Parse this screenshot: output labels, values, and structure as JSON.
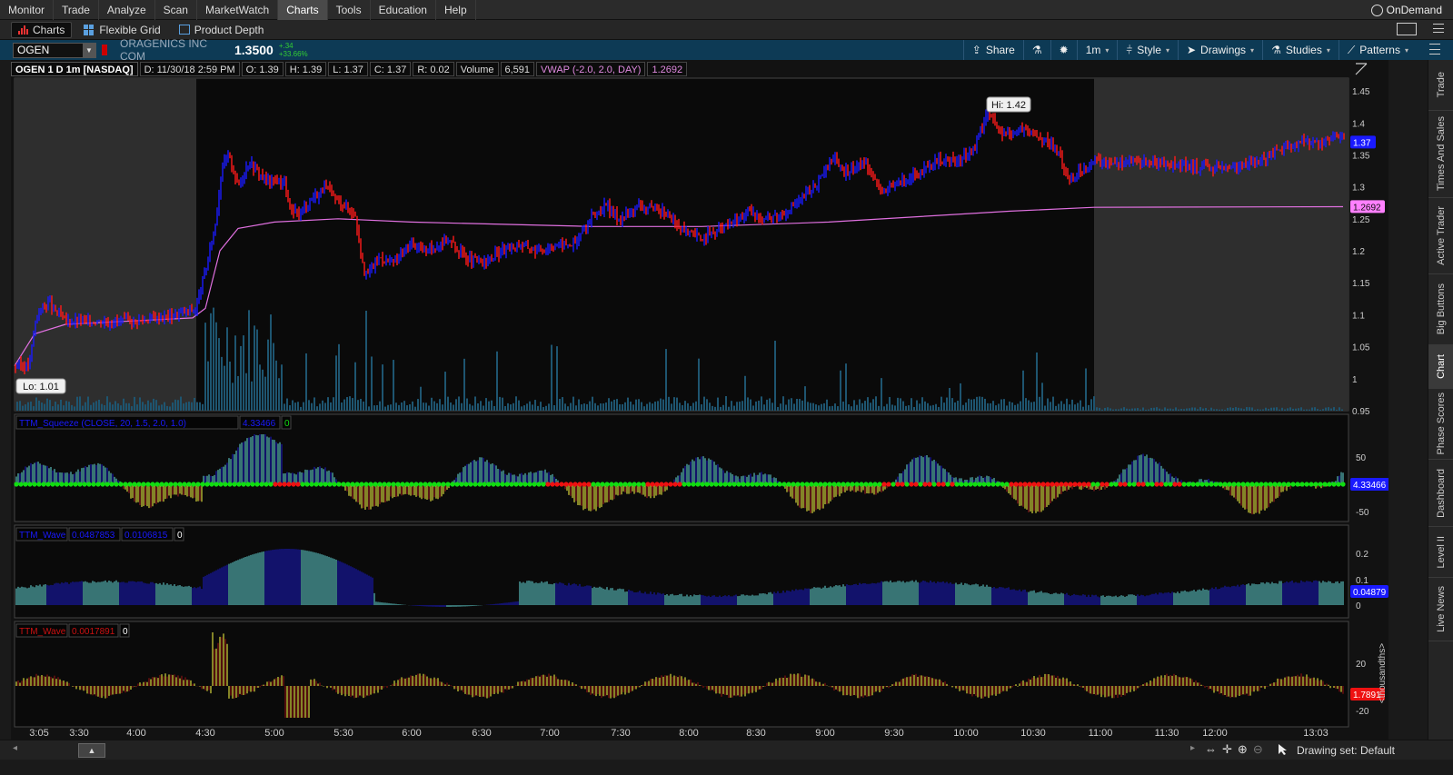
{
  "menu": {
    "items": [
      "Monitor",
      "Trade",
      "Analyze",
      "Scan",
      "MarketWatch",
      "Charts",
      "Tools",
      "Education",
      "Help"
    ],
    "active": "Charts",
    "ondemand": "OnDemand"
  },
  "subtabs": {
    "charts": "Charts",
    "flexible_grid": "Flexible Grid",
    "product_depth": "Product Depth"
  },
  "symbol": {
    "ticker": "OGEN",
    "company": "ORAGENICS INC COM",
    "last": "1.3500",
    "change_abs": "+.34",
    "change_pct": "+33.66%"
  },
  "toolbar": {
    "share": "Share",
    "interval": "1m",
    "style": "Style",
    "drawings": "Drawings",
    "studies": "Studies",
    "patterns": "Patterns"
  },
  "info": {
    "title": "OGEN 1 D 1m [NASDAQ]",
    "date": "D: 11/30/18 2:59 PM",
    "open": "O: 1.39",
    "high": "H: 1.39",
    "low": "L: 1.37",
    "close": "C: 1.37",
    "range": "R: 0.02",
    "volume_label": "Volume",
    "volume": "6,591",
    "vwap_label": "VWAP (-2.0, 2.0, DAY)",
    "vwap": "1.2692"
  },
  "price_panel": {
    "y_ticks": [
      "1.45",
      "1.4",
      "1.35",
      "1.3",
      "1.25",
      "1.2",
      "1.15",
      "1.1",
      "1.05",
      "1",
      "0.95"
    ],
    "ylim": [
      0.95,
      1.47
    ],
    "hi_label": "Hi: 1.42",
    "lo_label": "Lo: 1.01",
    "last_badge": "1.37",
    "vwap_badge": "1.2692"
  },
  "squeeze_panel": {
    "title": "TTM_Squeeze (CLOSE, 20, 1.5, 2.0, 1.0)",
    "value": "4.33466",
    "signal": "0",
    "y_ticks": [
      "50",
      "0",
      "-50"
    ],
    "badge": "4.33466"
  },
  "wave1_panel": {
    "title": "TTM_Wave",
    "value1": "0.0487853",
    "value2": "0.0106815",
    "value3": "0",
    "y_ticks": [
      "0.2",
      "0.1",
      "0"
    ],
    "badge": "0.04879"
  },
  "wave2_panel": {
    "title": "TTM_Wave",
    "value1": "0.0017891",
    "value2": "0",
    "y_ticks": [
      "20",
      "-20"
    ],
    "unit": "<thousandths>",
    "badge": "1.7891"
  },
  "x_axis": {
    "labels": [
      "3:05",
      "3:30",
      "4:00",
      "4:30",
      "5:00",
      "5:30",
      "6:00",
      "6:30",
      "7:00",
      "7:30",
      "8:00",
      "8:30",
      "9:00",
      "9:30",
      "10:00",
      "10:30",
      "11:00",
      "11:30",
      "12:00",
      "13:03"
    ]
  },
  "side_tabs": [
    "Trade",
    "Times And Sales",
    "Active Trader",
    "Big Buttons",
    "Chart",
    "Phase Scores",
    "Dashboard",
    "Level II",
    "Live News"
  ],
  "side_active": "Chart",
  "bottom": {
    "drawing_set": "Drawing set: Default"
  },
  "colors": {
    "up_bar": "#1a1aff",
    "down_bar": "#ff1a1a",
    "vwap": "#e070e0",
    "volume": "#1e5570",
    "squeeze_on": "#11dd11",
    "squeeze_off": "#ee1111",
    "wave_cyan": "#66dddd",
    "wave_blue": "#1a1acc",
    "wave_yellow": "#ffff44",
    "wave_darkred": "#991111"
  }
}
